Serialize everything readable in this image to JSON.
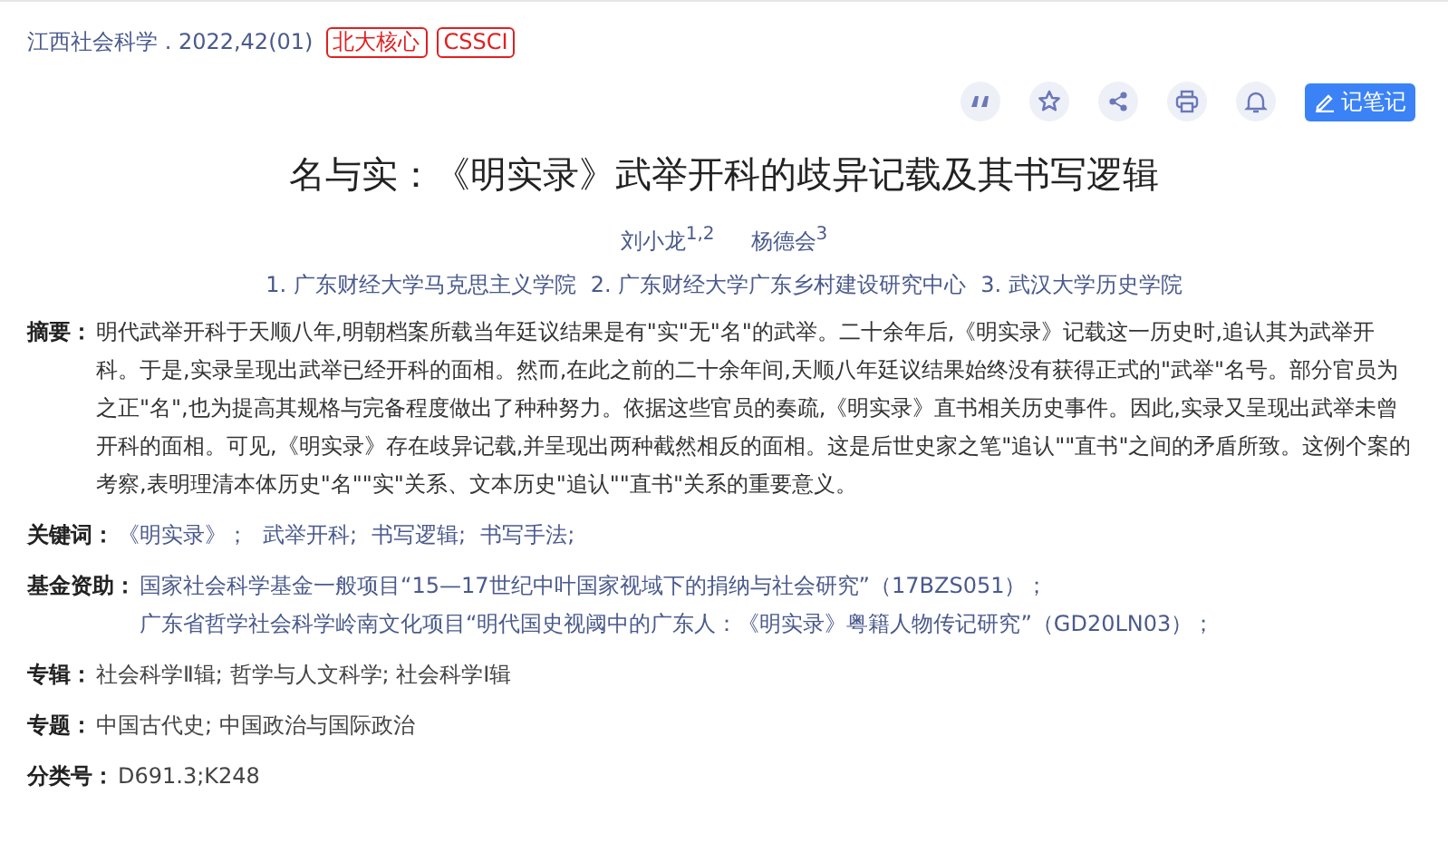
{
  "source": {
    "journal": "江西社会科学 . 2022,42(01)",
    "tags": [
      "北大核心",
      "CSSCI"
    ]
  },
  "actions": [
    {
      "kind": "quote"
    },
    {
      "kind": "star"
    },
    {
      "kind": "share"
    },
    {
      "kind": "print"
    },
    {
      "kind": "bell"
    },
    {
      "kind": "note",
      "label": "记笔记"
    }
  ],
  "title": "名与实：《明实录》武举开科的歧异记载及其书写逻辑",
  "authors": [
    "刘小龙$^{1,2}$",
    "杨德会$^{3}$"
  ],
  "affiliations": [
    "1. 广东财经大学马克思主义学院",
    "2. 广东财经大学广东乡村建设研究中心",
    "3. 武汉大学历史学院"
  ],
  "abstract": {
    "label": "摘要：",
    "text": "明代武举开科于天顺八年,明朝档案所载当年廷议结果是有\"实\"无\"名\"的武举。二十余年后,《明实录》记载这一历史时,追认其为武举开科。于是,实录呈现出武举已经开科的面相。然而,在此之前的二十余年间,天顺八年廷议结果始终没有获得正式的\"武举\"名号。部分官员为之正\"名\",也为提高其规格与完备程度做出了种种努力。依据这些官员的奏疏,《明实录》直书相关历史事件。因此,实录又呈现出武举未曾开科的面相。可见,《明实录》存在歧异记载,并呈现出两种截然相反的面相。这是后世史家之笔\"追认\"\"直书\"之间的矛盾所致。这例个案的考察,表明理清本体历史\"名\"\"实\"关系、文本历史\"追认\"\"直书\"关系的重要意义。"
  },
  "keywords": {
    "label": "关键词：",
    "items": [
      "《明实录》；",
      "武举开科;",
      "书写逻辑;",
      "书写手法;"
    ]
  },
  "funds": {
    "label": "基金资助：",
    "items": [
      "国家社会科学基金一般项目“15—17世纪中叶国家视域下的捐纳与社会研究”（17BZS051）；",
      "广东省哲学社会科学岭南文化项目“明代国史视阈中的广东人：《明实录》粤籍人物传记研究”（GD20LN03）；"
    ]
  },
  "fields": [
    {
      "label": "专辑：",
      "value": "社会科学Ⅱ辑; 哲学与人文科学; 社会科学Ⅰ辑"
    },
    {
      "label": "专题：",
      "value": "中国古代史; 中国政治与国际政治"
    },
    {
      "label": "分类号：",
      "value": "D691.3;K248"
    }
  ]
}
